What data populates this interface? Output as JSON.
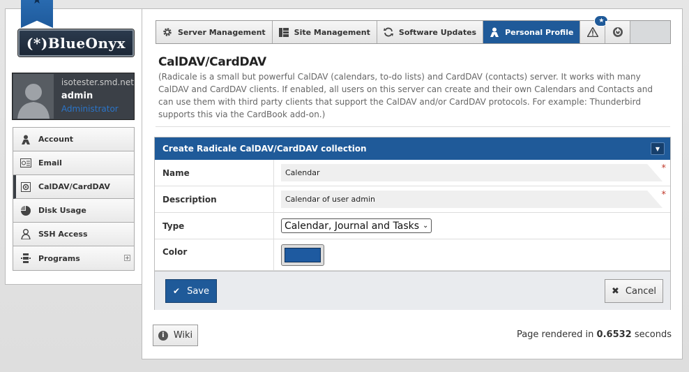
{
  "brand": {
    "logo_text": "(*)BlueOnyx"
  },
  "user": {
    "host": "isotester.smd.net",
    "name": "admin",
    "role": "Administrator"
  },
  "sidebar": {
    "items": [
      {
        "label": "Account",
        "icon": "account-icon"
      },
      {
        "label": "Email",
        "icon": "email-icon"
      },
      {
        "label": "CalDAV/CardDAV",
        "icon": "caldav-icon",
        "active": true
      },
      {
        "label": "Disk Usage",
        "icon": "pie-chart-icon"
      },
      {
        "label": "SSH Access",
        "icon": "ssh-user-icon"
      },
      {
        "label": "Programs",
        "icon": "programs-icon",
        "expand": "+"
      }
    ]
  },
  "tabs": [
    {
      "label": "Server Management",
      "icon": "gear-icon"
    },
    {
      "label": "Site Management",
      "icon": "grid-icon"
    },
    {
      "label": "Software Updates",
      "icon": "refresh-icon"
    },
    {
      "label": "Personal Profile",
      "icon": "person-icon",
      "active": true
    }
  ],
  "notifications": {
    "badge": "★"
  },
  "page": {
    "title": "CalDAV/CardDAV",
    "description": "(Radicale is a small but powerful CalDAV (calendars, to-do lists) and CardDAV (contacts) server. It works with many CalDAV and CardDAV clients. If enabled, all users on this server can create and their own Calendars and Contacts and can use them with third party clients that support the CalDAV and/or CardDAV protocols. For example: Thunderbird supports this via the CardBook add-on.)"
  },
  "form": {
    "header": "Create Radicale CalDAV/CardDAV collection",
    "fields": {
      "name": {
        "label": "Name",
        "value": "Calendar"
      },
      "description": {
        "label": "Description",
        "value": "Calendar of user admin"
      },
      "type": {
        "label": "Type",
        "value": "Calendar, Journal and Tasks"
      },
      "color": {
        "label": "Color",
        "value": "#1e5aa0"
      }
    },
    "required_mark": "*",
    "save_label": "Save",
    "cancel_label": "Cancel"
  },
  "footer": {
    "wiki_label": "Wiki",
    "rendered_prefix": "Page rendered in",
    "rendered_time": "0.6532",
    "rendered_suffix": "seconds"
  },
  "colors": {
    "accent": "#1f5a99",
    "header_dark": "#3b4047"
  }
}
